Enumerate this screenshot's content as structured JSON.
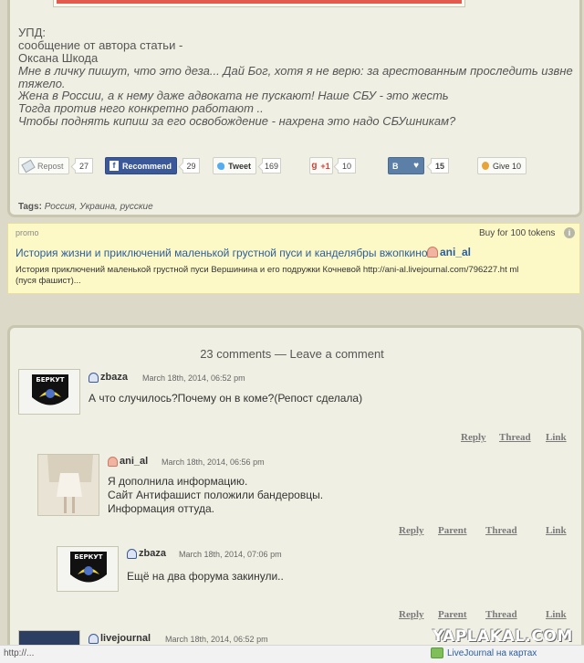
{
  "post": {
    "lines": [
      {
        "text": "УПД:",
        "italic": false
      },
      {
        "text": "сообщение от автора статьи -",
        "italic": false
      },
      {
        "text": "Оксана Шкода",
        "italic": false
      },
      {
        "text": "Мне в личку пишут, что это деза... Дай Бог, хотя я не верю: за арестованным проследить извне",
        "italic": true
      },
      {
        "text": "тяжело.",
        "italic": true
      },
      {
        "text": "Жена в России, а к нему даже адвоката не пускают! Наше СБУ - это жесть",
        "italic": true
      },
      {
        "text": "Тогда против него конкретно работают ..",
        "italic": true
      },
      {
        "text": "Чтобы поднять кипиш за его освобождение - нахрена это надо СБУшникам?",
        "italic": true
      }
    ],
    "share": {
      "repost_label": "Repost",
      "repost_count": "27",
      "recommend_label": "Recommend",
      "recommend_count": "29",
      "tweet_label": "Tweet",
      "tweet_count": "169",
      "gplus_label": "+1",
      "gplus_count": "10",
      "vk_label": "В",
      "vk_count": "15",
      "give_label": "Give 10"
    },
    "tags_label": "Tags:",
    "tags": "Россия, Украина, русские"
  },
  "promo": {
    "label": "promo",
    "buy_label": "Buy for 100 tokens",
    "info_icon": "i",
    "title": "История жизни и приключений маленькой грустной пуси и канделябры вжопкиной",
    "author": "ani_al",
    "description_line1": "История приключений маленькой грустной пуси Вершинина и его подружки Кочневой http://ani-al.livejournal.com/796227.ht ml",
    "description_line2": "(пуся фашист)..."
  },
  "comments_header": "23 comments — Leave a comment",
  "comments": [
    {
      "user": "zbaza",
      "date": "March 18th, 2014, 06:52 pm",
      "text_lines": [
        "А что случилось?Почему он в коме?(Репост сделала)"
      ],
      "links": [
        "Reply",
        "Thread",
        "Link"
      ]
    },
    {
      "user": "ani_al",
      "date": "March 18th, 2014, 06:56 pm",
      "text_lines": [
        "Я дополнила информацию.",
        "Сайт Антифашист положили бандеровцы.",
        "Информация оттуда."
      ],
      "links": [
        "Reply",
        "Parent",
        "Thread",
        "Link"
      ]
    },
    {
      "user": "zbaza",
      "date": "March 18th, 2014, 07:06 pm",
      "text_lines": [
        "Ещё на два форума закинули.."
      ],
      "links": [
        "Reply",
        "Parent",
        "Thread",
        "Link"
      ]
    },
    {
      "user": "livejournal",
      "date": "March 18th, 2014, 06:52 pm",
      "text_lines": [],
      "links": []
    }
  ],
  "avatar_badge_text": "БЕРКУТ",
  "watermark": "YAPLAKAL.COM",
  "status_bar": {
    "url": "http://...",
    "link_text": "LiveJournal на картах"
  },
  "colors": {
    "accent_link": "#2b5d9e",
    "facebook_blue": "#3b5998",
    "vk_blue": "#5b7fa6",
    "promo_bg": "#fdf9c7"
  }
}
